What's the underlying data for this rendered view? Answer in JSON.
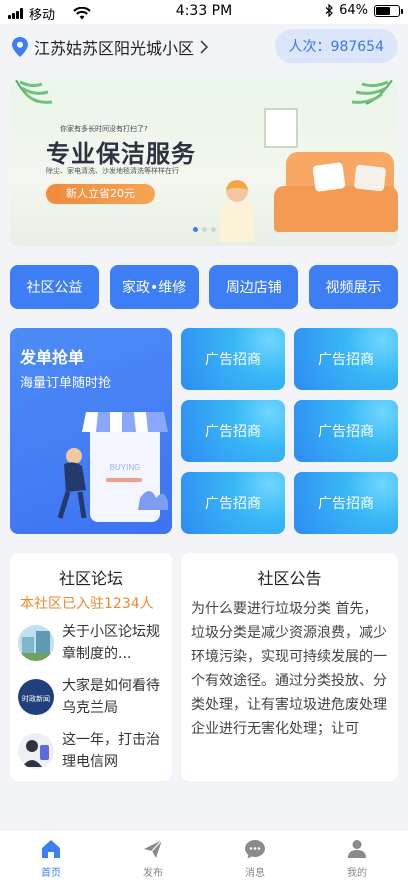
{
  "status_bar": {
    "carrier": "移动",
    "time": "4:33 PM",
    "battery": "64%",
    "battery_level": 0.64
  },
  "header": {
    "location": "江苏姑苏区阳光城小区",
    "visits": "人次：987654"
  },
  "banner": {
    "small_text": "你家有多长时间没有打扫了?",
    "title": "专业保洁服务",
    "subtitle": "除尘、家电清洗、沙发地毯清洗等样样在行",
    "promo": "新人立省20元",
    "carousel_count": 3,
    "carousel_active": 1
  },
  "categories": [
    {
      "label": "社区公益"
    },
    {
      "label": "家政•维修"
    },
    {
      "label": "周边店铺"
    },
    {
      "label": "视频展示"
    }
  ],
  "ad_big": {
    "title": "发单抢单",
    "subtitle": "海量订单随时抢",
    "buying": "BUYING"
  },
  "ad_tiles": [
    {
      "label": "广告招商"
    },
    {
      "label": "广告招商"
    },
    {
      "label": "广告招商"
    },
    {
      "label": "广告招商"
    },
    {
      "label": "广告招商"
    },
    {
      "label": "广告招商"
    }
  ],
  "forum": {
    "title": "社区论坛",
    "count": "本社区已入驻1234人",
    "items": [
      {
        "text": "关于小区论坛规章制度的..."
      },
      {
        "text": "大家是如何看待乌克兰局"
      },
      {
        "text": "这一年，打击治理电信网"
      }
    ],
    "thumb_label": "时政新闻"
  },
  "notice": {
    "title": "社区公告",
    "body": "为什么要进行垃圾分类 首先，垃圾分类是减少资源浪费，减少环境污染，实现可持续发展的一个有效途径。通过分类投放、分类处理，让有害垃圾进危废处理企业进行无害化处理；让可"
  },
  "tabbar": [
    {
      "label": "首页",
      "icon": "home-icon",
      "active": true
    },
    {
      "label": "发布",
      "icon": "send-icon",
      "active": false
    },
    {
      "label": "消息",
      "icon": "message-icon",
      "active": false
    },
    {
      "label": "我的",
      "icon": "user-icon",
      "active": false
    }
  ],
  "colors": {
    "accent": "#3d7ef5",
    "orange": "#ef8a2c",
    "background": "#f3f4f7"
  }
}
